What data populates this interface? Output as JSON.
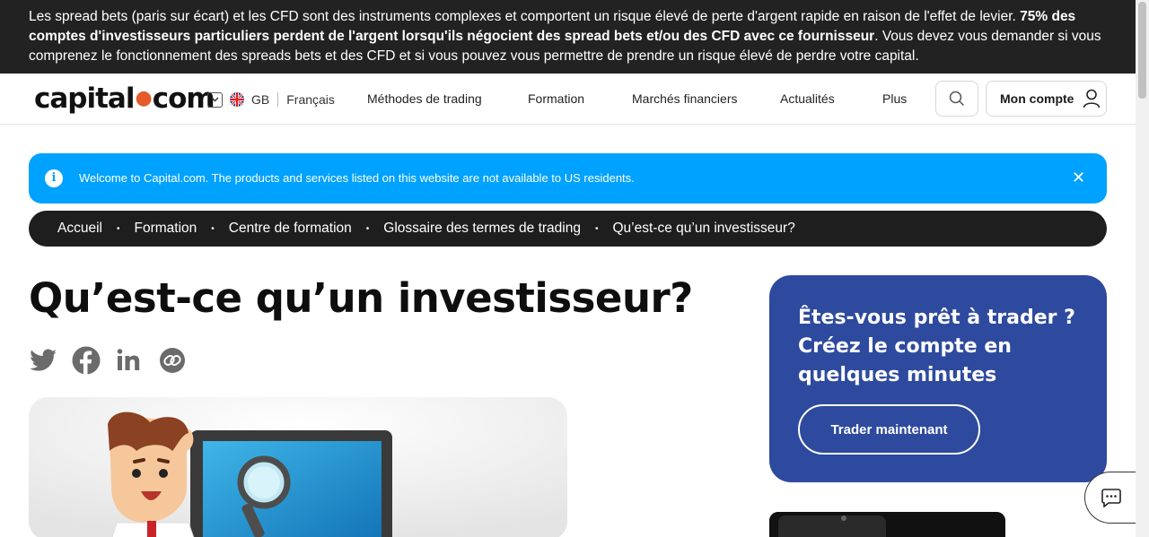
{
  "risk_banner": {
    "text_before": "Les spread bets (paris sur écart) et les CFD sont des instruments complexes et comportent un risque élevé de perte d'argent rapide en raison de l'effet de levier. ",
    "text_bold": "75% des comptes d'investisseurs particuliers perdent de l'argent lorsqu'ils négocient des spread bets et/ou des CFD avec ce fournisseur",
    "text_after": ". Vous devez vous demander si vous comprenez le fonctionnement des spreads bets et des CFD et si vous pouvez vous permettre de prendre un risque élevé de perdre votre capital."
  },
  "header": {
    "logo_left": "capital",
    "logo_dot": "●",
    "logo_right": "com",
    "region": "GB",
    "language": "Français",
    "nav": [
      "Méthodes de trading",
      "Formation",
      "Marchés financiers",
      "Actualités",
      "Plus"
    ],
    "account_label": "Mon compte"
  },
  "welcome": {
    "info_glyph": "i",
    "message": "Welcome to Capital.com. The products and services listed on this website are not available to US residents.",
    "close_glyph": "✕"
  },
  "breadcrumb": {
    "items": [
      "Accueil",
      "Formation",
      "Centre de formation",
      "Glossaire des termes de trading",
      "Qu’est-ce qu’un investisseur?"
    ],
    "separator": "•"
  },
  "article": {
    "title": "Qu’est-ce qu’un investisseur?"
  },
  "cta": {
    "heading": "Êtes-vous prêt à trader ? Créez le compte en quelques minutes",
    "button": "Trader maintenant"
  },
  "colors": {
    "risk_bg": "#222222",
    "welcome_bg": "#00a2ff",
    "cta_bg": "#2e4a9e",
    "logo_dot": "#e55a2b",
    "breadcrumb_bg": "#1e1e1e"
  },
  "icons": [
    "chevron-down-icon",
    "uk-flag-icon",
    "search-icon",
    "user-icon",
    "info-icon",
    "close-icon",
    "twitter-icon",
    "facebook-icon",
    "linkedin-icon",
    "copy-link-icon",
    "chat-icon"
  ]
}
